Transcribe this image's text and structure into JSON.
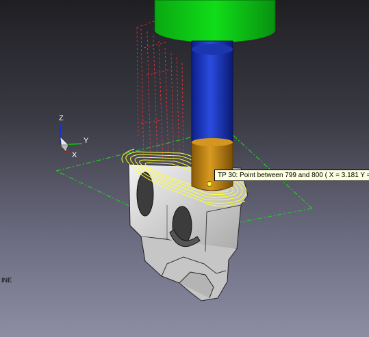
{
  "viewport": {
    "axis_triad": {
      "z_label": "Z",
      "y_label": "Y",
      "x_label": "X"
    },
    "tooltip": {
      "text": "TP 30: Point between 799 and 800 ( X = 3.181  Y = 11.3"
    },
    "mode_label": "INE"
  },
  "colors": {
    "spindle_holder": "#00cc10",
    "tool_shank": "#1538c8",
    "tool_flute": "#c08818",
    "toolpath_cut": "#ffff33",
    "toolpath_rapid": "#ff3030",
    "stock_boundary": "#22cc22",
    "part_body": "#d8d8d8"
  },
  "icons": [
    "axis-triad-icon",
    "toolpath-point-marker-icon"
  ]
}
